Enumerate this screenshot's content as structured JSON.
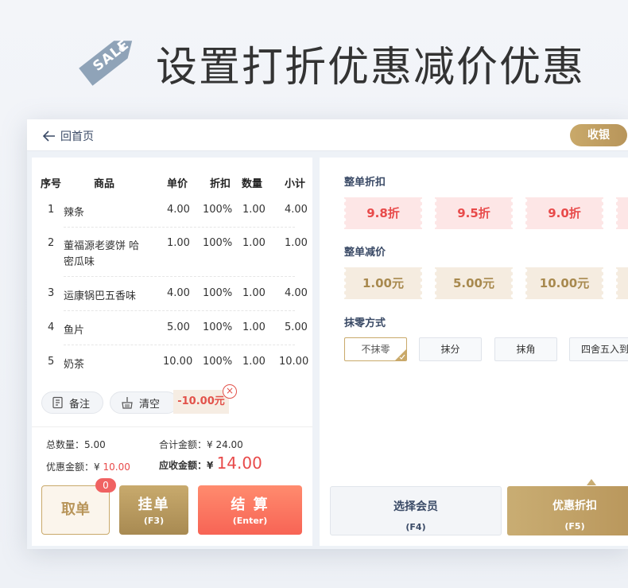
{
  "headline": {
    "sale_badge": "SALE",
    "text": "设置打折优惠减价优惠"
  },
  "topbar": {
    "back_label": "回首页",
    "cashier_label": "收银"
  },
  "table": {
    "headers": [
      "序号",
      "商品",
      "单价",
      "折扣",
      "数量",
      "小计"
    ],
    "rows": [
      {
        "no": "1",
        "name1": "辣条",
        "name2": "",
        "price": "4.00",
        "discount": "100%",
        "qty": "1.00",
        "subtotal": "4.00"
      },
      {
        "no": "2",
        "name1": "董福源老婆饼 哈",
        "name2": "密瓜味",
        "price": "1.00",
        "discount": "100%",
        "qty": "1.00",
        "subtotal": "1.00"
      },
      {
        "no": "3",
        "name1": "运康锅巴五香味",
        "name2": "",
        "price": "4.00",
        "discount": "100%",
        "qty": "1.00",
        "subtotal": "4.00"
      },
      {
        "no": "4",
        "name1": "鱼片",
        "name2": "",
        "price": "5.00",
        "discount": "100%",
        "qty": "1.00",
        "subtotal": "5.00"
      },
      {
        "no": "5",
        "name1": "奶茶",
        "name2": "",
        "price": "10.00",
        "discount": "100%",
        "qty": "1.00",
        "subtotal": "10.00"
      }
    ]
  },
  "actions": {
    "note_label": "备注",
    "clear_label": "清空",
    "discount_chip": "-10.00元"
  },
  "summary": {
    "total_qty_label": "总数量：",
    "total_qty": "5.00",
    "total_amount_label": "合计金额：",
    "total_amount": "¥ 24.00",
    "discount_label": "优惠金额：",
    "discount_currency": "¥",
    "discount_amount": "10.00",
    "due_label": "应收金额：",
    "due_currency": "¥",
    "due_amount": "14.00"
  },
  "buttons": {
    "cancel_label": "取单",
    "cancel_badge": "0",
    "hold_label": "挂单",
    "hold_key": "(F3)",
    "checkout_label": "结 算",
    "checkout_key": "(Enter)"
  },
  "promo": {
    "whole_discount_title": "整单折扣",
    "whole_discounts": [
      "9.8折",
      "9.5折",
      "9.0折"
    ],
    "whole_reduce_title": "整单减价",
    "whole_reduces": [
      "1.00元",
      "5.00元",
      "10.00元"
    ],
    "rounding_title": "抹零方式",
    "rounding_options": [
      "不抹零",
      "抹分",
      "抹角",
      "四舍五入到"
    ],
    "member_label": "选择会员",
    "member_key": "(F4)",
    "promo_label": "优惠折扣",
    "promo_key": "(F5)"
  },
  "colors": {
    "gold": "#c9a96a",
    "red": "#e84a4a",
    "orange": "#f76455",
    "navy": "#3a4a66"
  }
}
